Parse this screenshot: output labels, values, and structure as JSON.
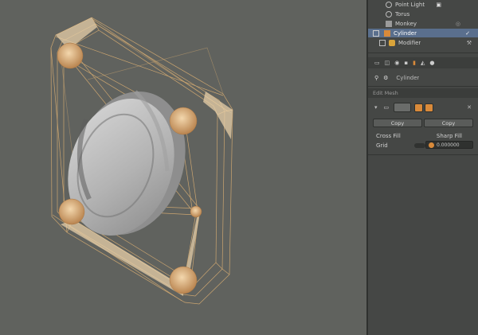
{
  "outliner": {
    "items": [
      {
        "label": "Point Light",
        "icon": "light-icon"
      },
      {
        "label": "Torus",
        "icon": "torus-icon"
      },
      {
        "label": "Monkey",
        "icon": "mesh-icon"
      },
      {
        "label": "Cylinder",
        "icon": "mesh-icon",
        "selected": true
      },
      {
        "label": "Modifier",
        "icon": "modifier-icon"
      }
    ]
  },
  "properties": {
    "context_label": "Cylinder",
    "section_title": "Edit Mesh",
    "left_button": "Copy",
    "right_button": "Copy",
    "label_1": "Cross Fill",
    "label_2": "Sharp Fill",
    "value_label": "Grid",
    "field_value": "0.000000"
  },
  "colors": {
    "panel_bg": "#454745",
    "viewport_bg": "#60625e",
    "selection": "#5a6f8d",
    "accent_orange": "#d98a3a"
  }
}
